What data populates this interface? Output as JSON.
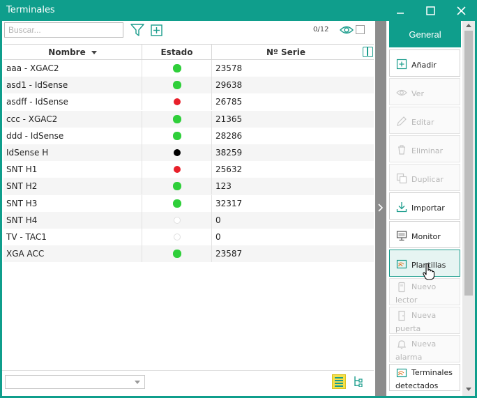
{
  "window": {
    "title": "Terminales",
    "colors": {
      "accent": "#0f9e8c",
      "online": "#2fcf3a",
      "alarm": "#e8202a"
    }
  },
  "toolbar": {
    "search_placeholder": "Buscar...",
    "filter_icon": "filter-icon",
    "add_icon": "plus-square-icon",
    "counter": "0/12",
    "visibility_icon": "eye-icon"
  },
  "grid": {
    "columns": [
      "Nombre",
      "Estado",
      "Nº Serie"
    ],
    "rows": [
      {
        "nombre": "aaa - XGAC2",
        "estado": "green",
        "serie": "23578"
      },
      {
        "nombre": "asd1 - IdSense",
        "estado": "green",
        "serie": "29638"
      },
      {
        "nombre": "asdff - IdSense",
        "estado": "red",
        "serie": "26785"
      },
      {
        "nombre": "ccc - XGAC2",
        "estado": "green",
        "serie": "21365"
      },
      {
        "nombre": "ddd - IdSense",
        "estado": "green",
        "serie": "28286"
      },
      {
        "nombre": "IdSense H",
        "estado": "black",
        "serie": "38259"
      },
      {
        "nombre": "SNT H1",
        "estado": "red",
        "serie": "25632"
      },
      {
        "nombre": "SNT H2",
        "estado": "green",
        "serie": "123"
      },
      {
        "nombre": "SNT H3",
        "estado": "green",
        "serie": "32317"
      },
      {
        "nombre": "SNT H4",
        "estado": "empty",
        "serie": "0"
      },
      {
        "nombre": "TV - TAC1",
        "estado": "empty",
        "serie": "0"
      },
      {
        "nombre": "XGA ACC",
        "estado": "green",
        "serie": "23587"
      }
    ]
  },
  "side": {
    "tab": "General",
    "actions": [
      {
        "label": "Añadir",
        "icon": "plus-square-icon",
        "state": "enabled"
      },
      {
        "label": "Ver",
        "icon": "eye-icon",
        "state": "disabled"
      },
      {
        "label": "Editar",
        "icon": "pencil-icon",
        "state": "disabled"
      },
      {
        "label": "Eliminar",
        "icon": "trash-icon",
        "state": "disabled"
      },
      {
        "label": "Duplicar",
        "icon": "copy-icon",
        "state": "disabled"
      },
      {
        "label": "Importar",
        "icon": "download-icon",
        "state": "enabled"
      },
      {
        "label": "Monitor",
        "icon": "monitor-icon",
        "state": "enabled"
      },
      {
        "label": "Plantillas",
        "icon": "template-icon",
        "state": "active"
      },
      {
        "label": "Nuevo lector",
        "icon": "reader-icon",
        "state": "disabled"
      },
      {
        "label": "Nueva puerta",
        "icon": "door-icon",
        "state": "disabled"
      },
      {
        "label": "Nueva alarma",
        "icon": "bell-icon",
        "state": "disabled"
      },
      {
        "label": "Terminales detectados",
        "icon": "template-icon",
        "state": "enabled"
      }
    ]
  }
}
